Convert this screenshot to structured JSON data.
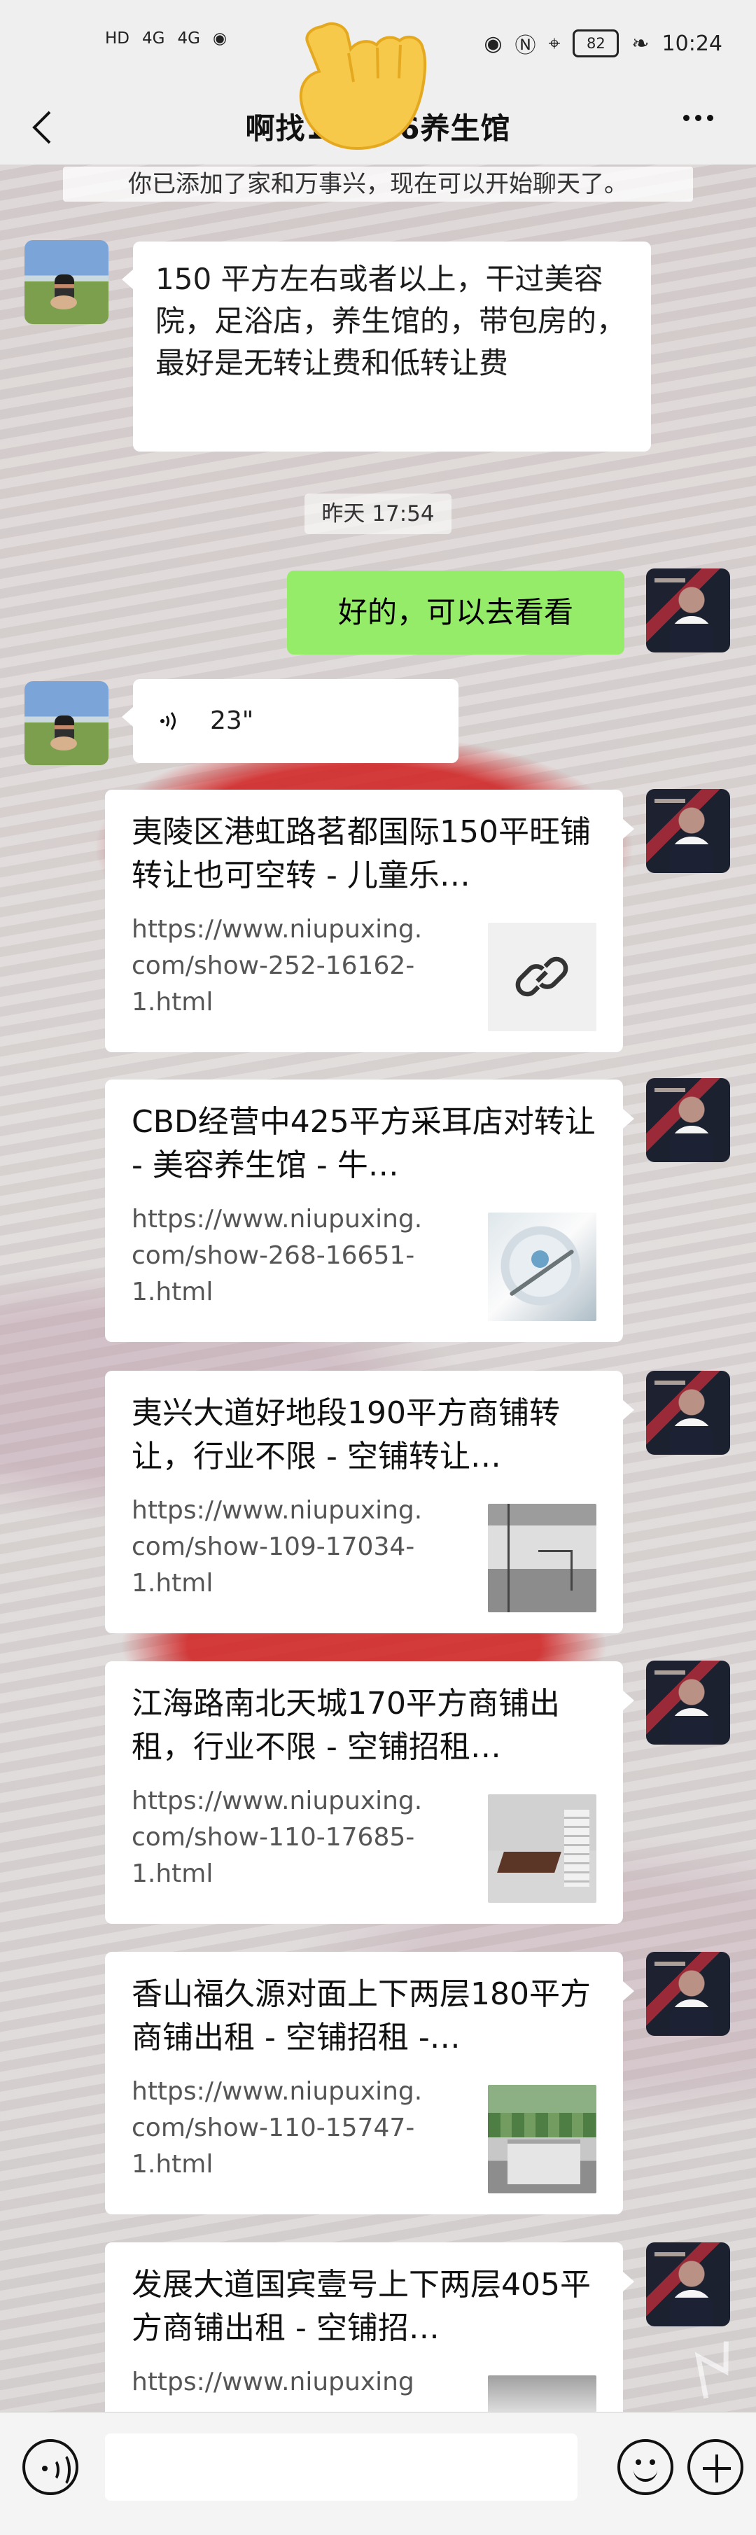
{
  "status_bar": {
    "left_indicators": [
      "HD",
      "4G",
      "4G"
    ],
    "battery": "82",
    "time": "10:24"
  },
  "header": {
    "title": "啊找17…76养生馆"
  },
  "system_note": "你已添加了家和万事兴，现在可以开始聊天了。",
  "messages": [
    {
      "side": "left",
      "text": "150 平方左右或者以上，干过美容院，足浴店，养生馆的，带包房的，最好是无转让费和低转让费"
    },
    {
      "time_label": "昨天 17:54"
    },
    {
      "side": "right",
      "text": "好的，可以去看看"
    },
    {
      "side": "left",
      "voice_duration": "23\""
    }
  ],
  "link_cards": [
    {
      "title": "夷陵区港虹路茗都国际150平旺铺转让也可空转 - 儿童乐…",
      "url": "https://www.niupuxing.com/show-252-16162-1.html",
      "thumb": "link-icon"
    },
    {
      "title": "CBD经营中425平方采耳店对转让 - 美容养生馆 - 牛…",
      "url": "https://www.niupuxing.com/show-268-16651-1.html",
      "thumb": "plate"
    },
    {
      "title": "夷兴大道好地段190平方商铺转让，行业不限 - 空铺转让…",
      "url": "https://www.niupuxing.com/show-109-17034-1.html",
      "thumb": "room"
    },
    {
      "title": "江海路南北天城170平方商铺出租，行业不限 - 空铺招租…",
      "url": "https://www.niupuxing.com/show-110-17685-1.html",
      "thumb": "office"
    },
    {
      "title": "香山福久源对面上下两层180平方商铺出租 - 空铺招租 -…",
      "url": "https://www.niupuxing.com/show-110-15747-1.html",
      "thumb": "street"
    },
    {
      "title": "发展大道国宾壹号上下两层405平方商铺出租 - 空铺招…",
      "url": "https://www.niupuxing",
      "thumb": "cutoff"
    }
  ],
  "bottom_bar": {
    "input_placeholder": ""
  },
  "colors": {
    "header_bg": "#efefef",
    "chat_bg": "#d9d4d3",
    "self_bubble": "#95ec69",
    "accent_red": "#d01616"
  }
}
